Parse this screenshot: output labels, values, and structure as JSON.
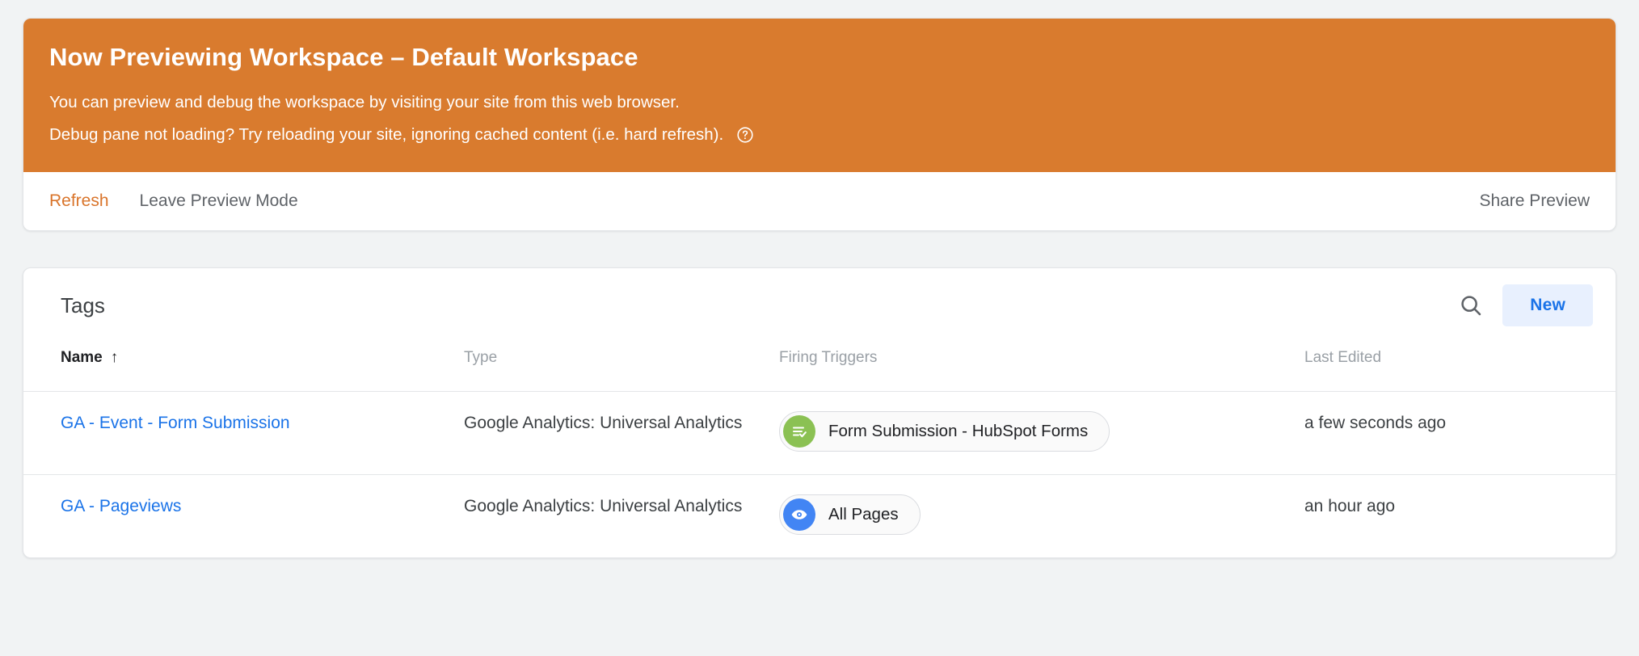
{
  "preview_banner": {
    "title": "Now Previewing Workspace – Default Workspace",
    "line1": "You can preview and debug the workspace by visiting your site from this web browser.",
    "line2": "Debug pane not loading? Try reloading your site, ignoring cached content (i.e. hard refresh).",
    "help_icon": "help-circle-icon",
    "background_color": "#D97B2E"
  },
  "action_bar": {
    "refresh_label": "Refresh",
    "leave_preview_label": "Leave Preview Mode",
    "share_preview_label": "Share Preview",
    "refresh_color": "#D9742A",
    "default_color": "#5F6368"
  },
  "tags_panel": {
    "title": "Tags",
    "search_icon": "search-icon",
    "new_button_label": "New",
    "new_button_bg": "#E8F0FE",
    "new_button_color": "#1A73E8",
    "columns": {
      "name": "Name",
      "type": "Type",
      "firing_triggers": "Firing Triggers",
      "last_edited": "Last Edited"
    },
    "sort": {
      "column": "Name",
      "direction": "ascending",
      "arrow_glyph": "↑"
    },
    "rows": [
      {
        "name": "GA - Event - Form Submission",
        "type": "Google Analytics: Universal Analytics",
        "trigger": {
          "label": "Form Submission - HubSpot Forms",
          "icon": "form-submission-icon",
          "icon_color": "#8BC153"
        },
        "last_edited": "a few seconds ago"
      },
      {
        "name": "GA - Pageviews",
        "type": "Google Analytics: Universal Analytics",
        "trigger": {
          "label": "All Pages",
          "icon": "pageview-eye-icon",
          "icon_color": "#4285F4"
        },
        "last_edited": "an hour ago"
      }
    ]
  }
}
